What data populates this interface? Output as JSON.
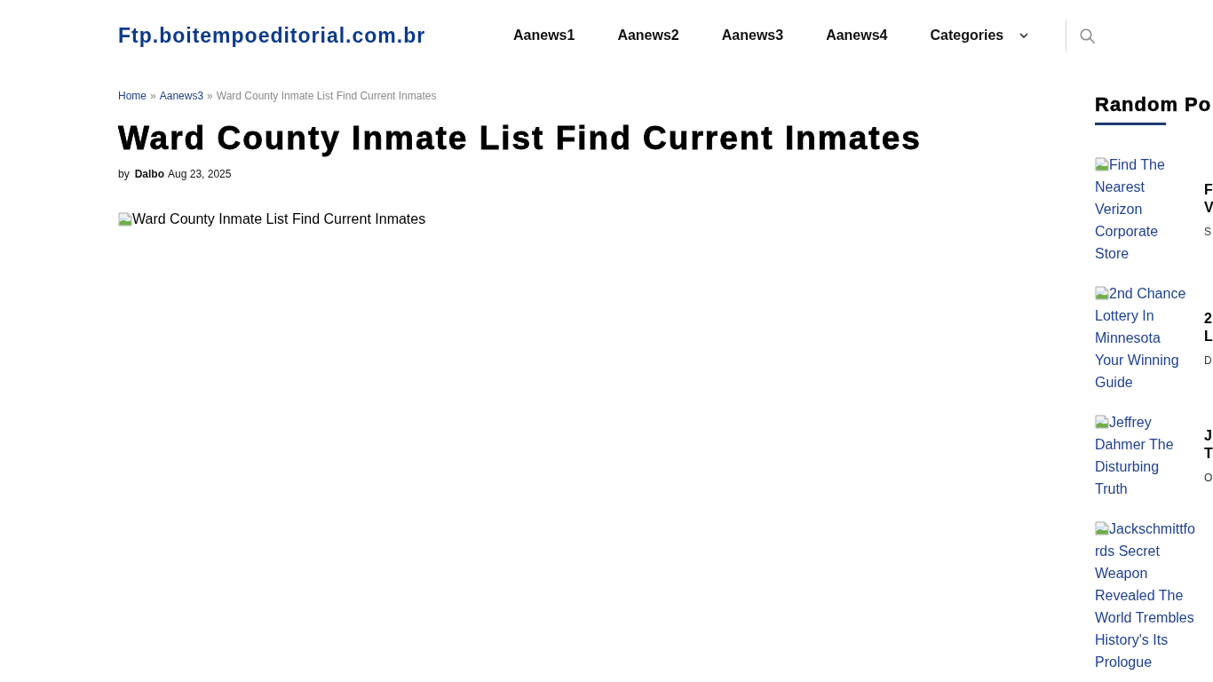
{
  "header": {
    "logo": "Ftp.boitempoeditorial.com.br",
    "nav": [
      {
        "label": "Aanews1",
        "kind": "link"
      },
      {
        "label": "Aanews2",
        "kind": "link"
      },
      {
        "label": "Aanews3",
        "kind": "link"
      },
      {
        "label": "Aanews4",
        "kind": "link"
      },
      {
        "label": "Categories",
        "kind": "dropdown"
      }
    ]
  },
  "breadcrumb": [
    {
      "label": "Home",
      "kind": "link"
    },
    {
      "label": "»",
      "kind": "separator"
    },
    {
      "label": "Aanews3",
      "kind": "link"
    },
    {
      "label": "»",
      "kind": "separator"
    },
    {
      "label": "Ward County Inmate List Find Current Inmates",
      "kind": "current"
    }
  ],
  "article": {
    "title": "Ward County Inmate List Find Current Inmates",
    "byline": {
      "prefix": "by",
      "author": "Dalbo",
      "date": "Aug 23, 2025"
    },
    "image_alt": "Ward County Inmate List Find Current Inmates"
  },
  "sidebar": {
    "heading": "Random Po",
    "posts": [
      {
        "image_alt": "Find The Nearest Verizon Corporate Store",
        "title_lines": [
          "F",
          "V"
        ],
        "meta": "S"
      },
      {
        "image_alt": "2nd Chance Lottery In Minnesota Your Winning Guide",
        "title_lines": [
          "2",
          "L"
        ],
        "meta": "D"
      },
      {
        "image_alt": "Jeffrey Dahmer The Disturbing Truth",
        "title_lines": [
          "J",
          "T"
        ],
        "meta": "O"
      },
      {
        "image_alt": "Jackschmittfords Secret Weapon Revealed The World Trembles History's Its Prologue"
      }
    ]
  }
}
